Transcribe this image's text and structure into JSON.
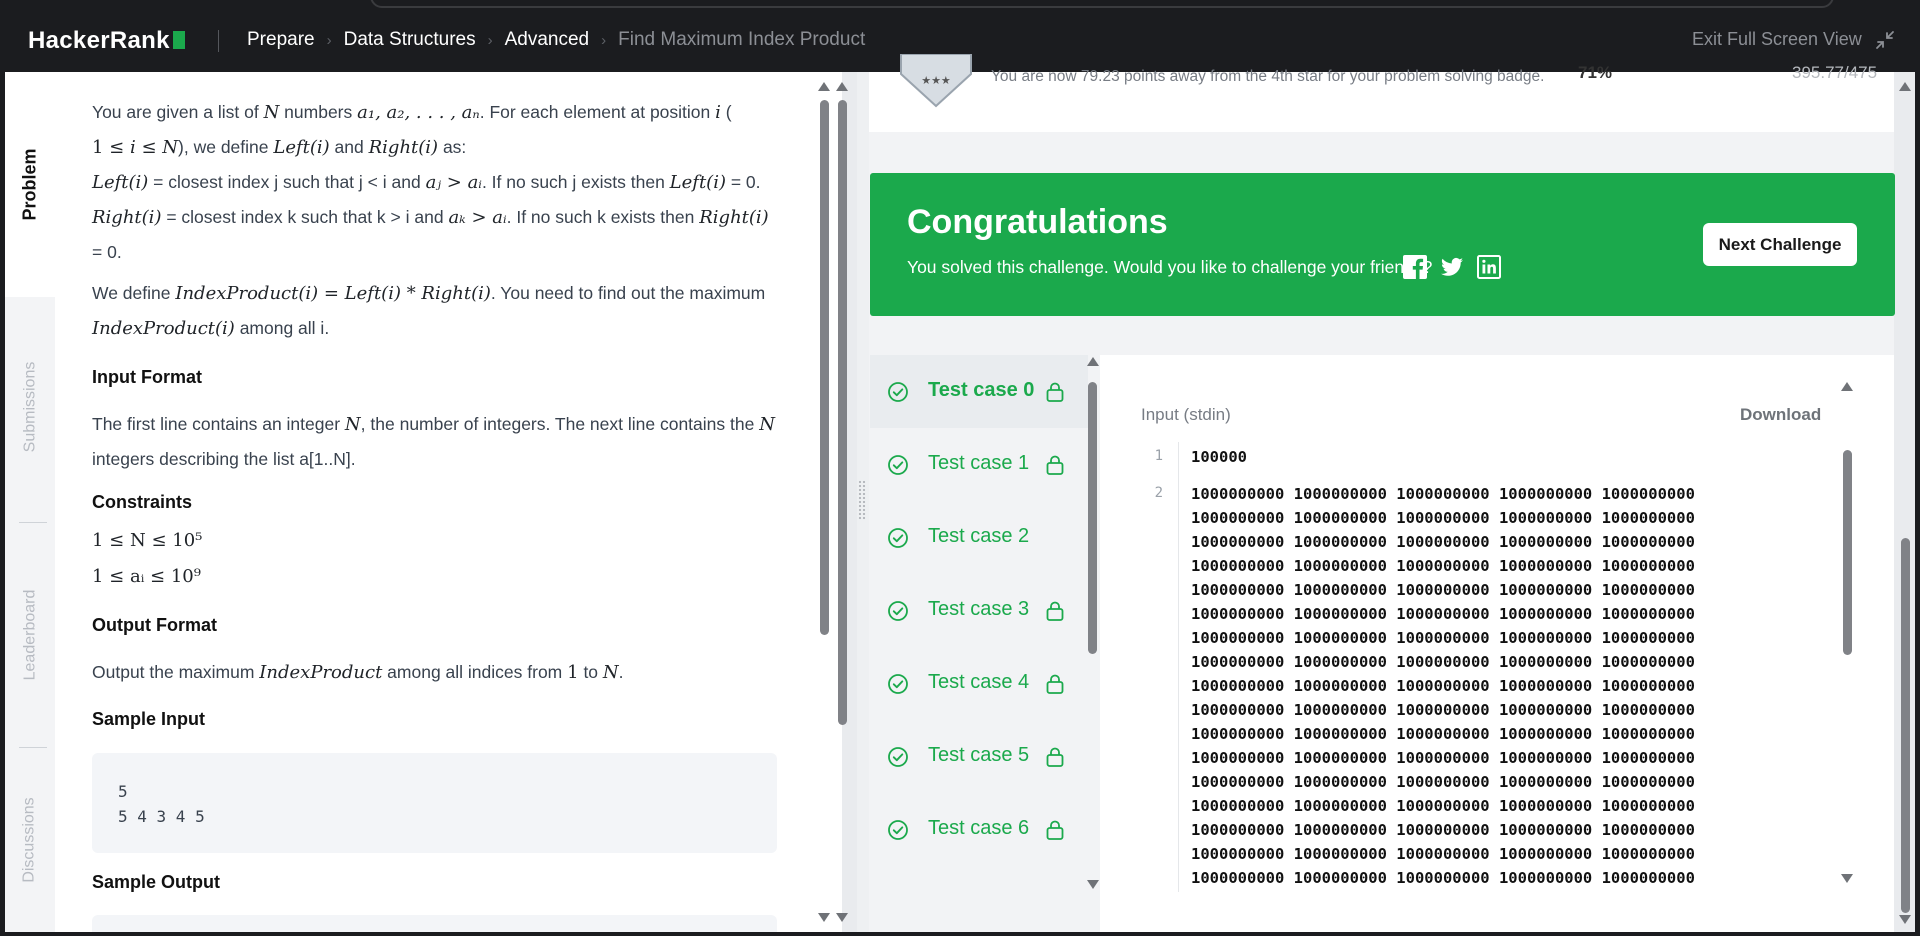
{
  "header": {
    "logo": "HackerRank",
    "breadcrumbs": [
      "Prepare",
      "Data Structures",
      "Advanced",
      "Find Maximum Index Product"
    ],
    "exit_fullscreen": "Exit Full Screen View"
  },
  "side_tabs": [
    "Problem",
    "Submissions",
    "Leaderboard",
    "Discussions"
  ],
  "problem": {
    "p1a": "You are given a list of ",
    "N": "N",
    "p1b": " numbers ",
    "seq": "a₁, a₂, . . . , aₙ",
    "p1c": ". For each element at position ",
    "i": "i",
    "p1d": " (",
    "p2a": "1 ≤ ",
    "p2b": " ≤ ",
    "p2c": "), we define ",
    "left_i": "Left(i)",
    "and": " and ",
    "right_i": "Right(i)",
    "as": " as:",
    "l3a": " = closest index j such that j < i and ",
    "aj_gt_ai": "aⱼ > aᵢ",
    "l3b": ". If no such j exists then ",
    "eq0": " = 0.",
    "l4a": " = closest index k such that k > i and ",
    "ak_gt_ai": "aₖ > aᵢ",
    "l4b": ". If no such k exists then ",
    "l5": "= 0.",
    "l6a": "We define ",
    "idx_def": "IndexProduct(i) = Left(i) * Right(i)",
    "l6b": ". You need to find out the maximum",
    "idx_i": "IndexProduct(i)",
    "l7b": " among all i.",
    "input_format_h": "Input Format",
    "if1a": "The first line contains an integer ",
    "if1b": ", the number of integers. The next line contains the ",
    "if2": "integers describing the list a[1..N].",
    "constraints_h": "Constraints",
    "c1": "1 ≤ N ≤ 10⁵",
    "c2": "1 ≤ aᵢ ≤ 10⁹",
    "output_format_h": "Output Format",
    "of_a": "Output the maximum ",
    "idx": "IndexProduct",
    "of_b": " among all indices from ",
    "one": "1",
    "to": " to ",
    "dot": ".",
    "sample_input_h": "Sample Input",
    "sample_input": "5\n5 4 3 4 5",
    "sample_output_h": "Sample Output"
  },
  "badge": {
    "stars": "★★★",
    "message": "You are now 79.23 points away from the 4th star for your problem solving badge.",
    "percent": "71%",
    "score": "395.77/475"
  },
  "congrats": {
    "title": "Congratulations",
    "subtitle": "You solved this challenge. Would you like to challenge your friends?",
    "next_button": "Next Challenge",
    "social": [
      "facebook-icon",
      "twitter-icon",
      "linkedin-icon"
    ]
  },
  "test_cases": [
    {
      "label": "Test case 0",
      "locked": true
    },
    {
      "label": "Test case 1",
      "locked": true
    },
    {
      "label": "Test case 2",
      "locked": false
    },
    {
      "label": "Test case 3",
      "locked": true
    },
    {
      "label": "Test case 4",
      "locked": true
    },
    {
      "label": "Test case 5",
      "locked": true
    },
    {
      "label": "Test case 6",
      "locked": true
    }
  ],
  "io": {
    "label": "Input (stdin)",
    "download": "Download",
    "line_numbers": [
      "1",
      "2"
    ],
    "line1": "100000",
    "rows": [
      "1000000000 1000000000 1000000000 1000000000 1000000000",
      "1000000000 1000000000 1000000000 1000000000 1000000000",
      "1000000000 1000000000 1000000000 1000000000 1000000000",
      "1000000000 1000000000 1000000000 1000000000 1000000000",
      "1000000000 1000000000 1000000000 1000000000 1000000000",
      "1000000000 1000000000 1000000000 1000000000 1000000000",
      "1000000000 1000000000 1000000000 1000000000 1000000000",
      "1000000000 1000000000 1000000000 1000000000 1000000000",
      "1000000000 1000000000 1000000000 1000000000 1000000000",
      "1000000000 1000000000 1000000000 1000000000 1000000000",
      "1000000000 1000000000 1000000000 1000000000 1000000000",
      "1000000000 1000000000 1000000000 1000000000 1000000000",
      "1000000000 1000000000 1000000000 1000000000 1000000000",
      "1000000000 1000000000 1000000000 1000000000 1000000000",
      "1000000000 1000000000 1000000000 1000000000 1000000000",
      "1000000000 1000000000 1000000000 1000000000 1000000000",
      "1000000000 1000000000 1000000000 1000000000 1000000000"
    ]
  },
  "colors": {
    "brand_green": "#1ba94c",
    "topbar": "#1b1c1f"
  }
}
